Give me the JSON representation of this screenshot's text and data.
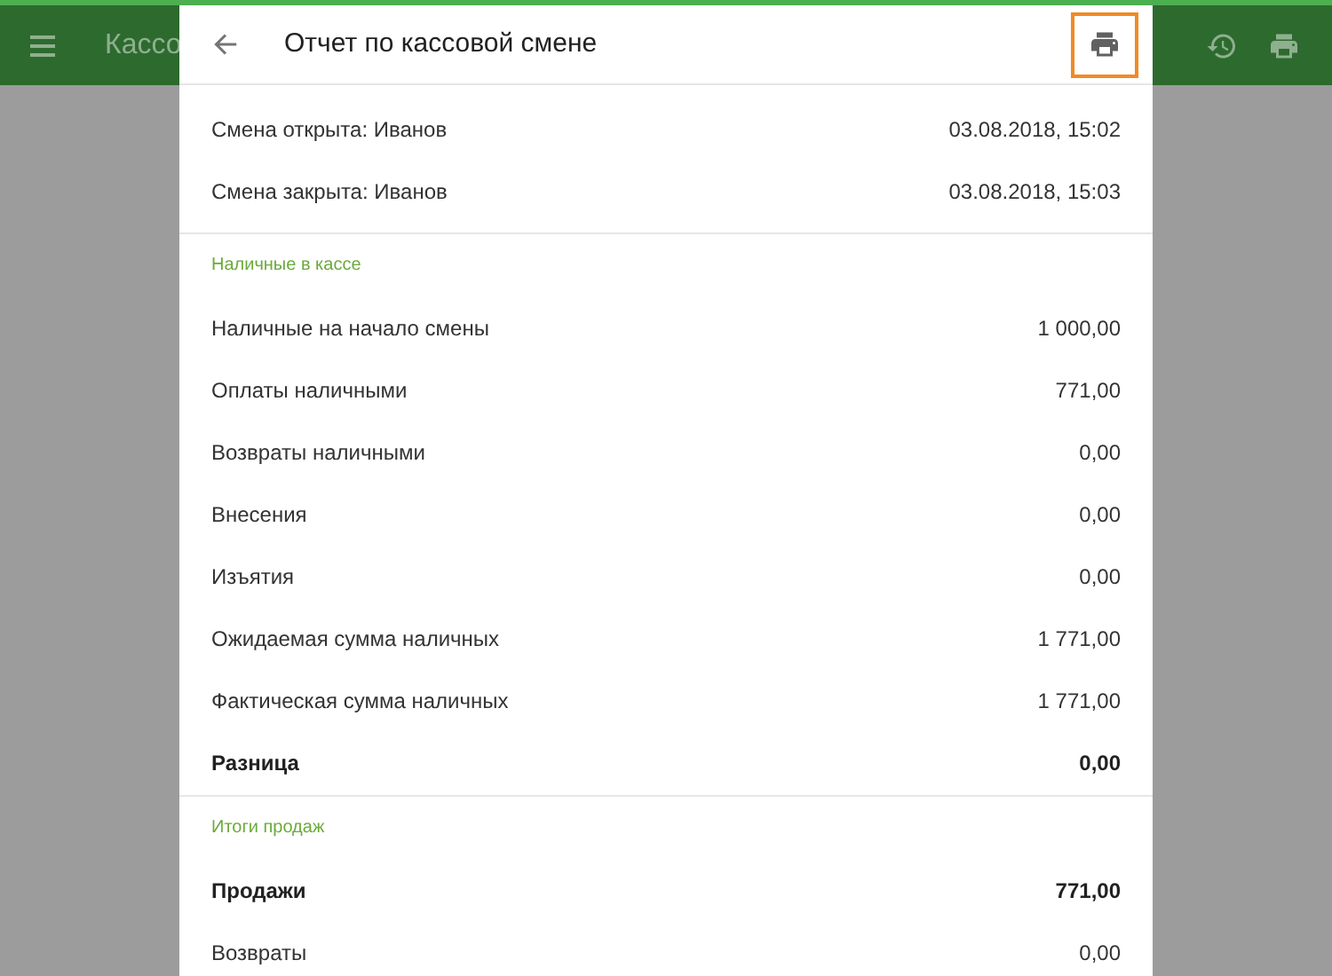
{
  "app_bar": {
    "title": "Кассо"
  },
  "dialog": {
    "title": "Отчет по кассовой смене",
    "print_highlighted": true,
    "shift_rows": [
      {
        "label": "Смена открыта: Иванов",
        "value": "03.08.2018, 15:02"
      },
      {
        "label": "Смена закрыта: Иванов",
        "value": "03.08.2018, 15:03"
      }
    ],
    "sections": [
      {
        "heading": "Наличные в кассе",
        "rows": [
          {
            "label": "Наличные на начало смены",
            "value": "1 000,00",
            "bold": false
          },
          {
            "label": "Оплаты наличными",
            "value": "771,00",
            "bold": false
          },
          {
            "label": "Возвраты наличными",
            "value": "0,00",
            "bold": false
          },
          {
            "label": "Внесения",
            "value": "0,00",
            "bold": false
          },
          {
            "label": "Изъятия",
            "value": "0,00",
            "bold": false
          },
          {
            "label": "Ожидаемая сумма наличных",
            "value": "1 771,00",
            "bold": false
          },
          {
            "label": "Фактическая сумма наличных",
            "value": "1 771,00",
            "bold": false
          },
          {
            "label": "Разница",
            "value": "0,00",
            "bold": true
          }
        ]
      },
      {
        "heading": "Итоги продаж",
        "rows": [
          {
            "label": "Продажи",
            "value": "771,00",
            "bold": true
          },
          {
            "label": "Возвраты",
            "value": "0,00",
            "bold": false
          }
        ]
      }
    ]
  }
}
